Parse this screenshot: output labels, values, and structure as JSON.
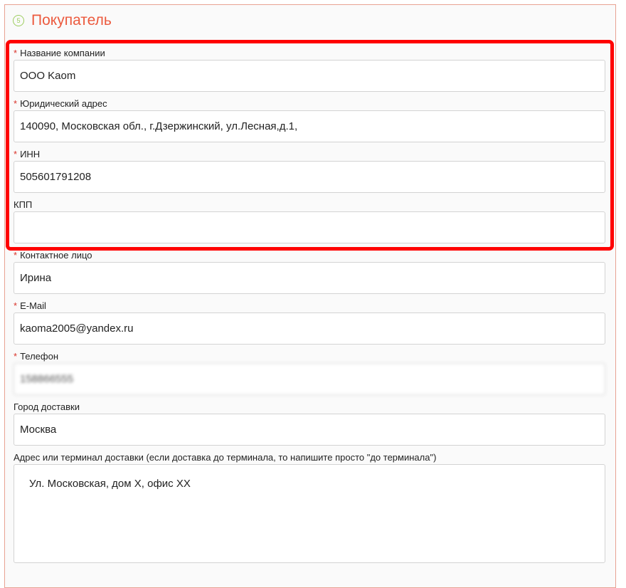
{
  "section": {
    "step": "5",
    "title": "Покупатель"
  },
  "fields": {
    "company_name": {
      "label": "Название компании",
      "required": "*",
      "value": "ООО Kaom"
    },
    "legal_address": {
      "label": "Юридический адрес",
      "required": "*",
      "value": "140090, Московская обл., г.Дзержинский, ул.Лесная,д.1,"
    },
    "inn": {
      "label": "ИНН",
      "required": "*",
      "value": "505601791208"
    },
    "kpp": {
      "label": "КПП",
      "value": ""
    },
    "contact_person": {
      "label": "Контактное лицо",
      "required": "*",
      "value": "Ирина"
    },
    "email": {
      "label": "E-Mail",
      "required": "*",
      "value": "kaoma2005@yandex.ru"
    },
    "phone": {
      "label": "Телефон",
      "required": "*",
      "value": "158866555"
    },
    "delivery_city": {
      "label": "Город доставки",
      "value": "Москва"
    },
    "delivery_address": {
      "label": "Адрес или терминал доставки (если доставка до терминала, то напишите просто \"до терминала\")",
      "value": "Ул. Московская, дом Х, офис ХХ"
    }
  },
  "colors": {
    "accent": "#ec5a3e",
    "step": "#9ccd5e",
    "highlight": "#ff0000",
    "required": "#d9342b"
  }
}
